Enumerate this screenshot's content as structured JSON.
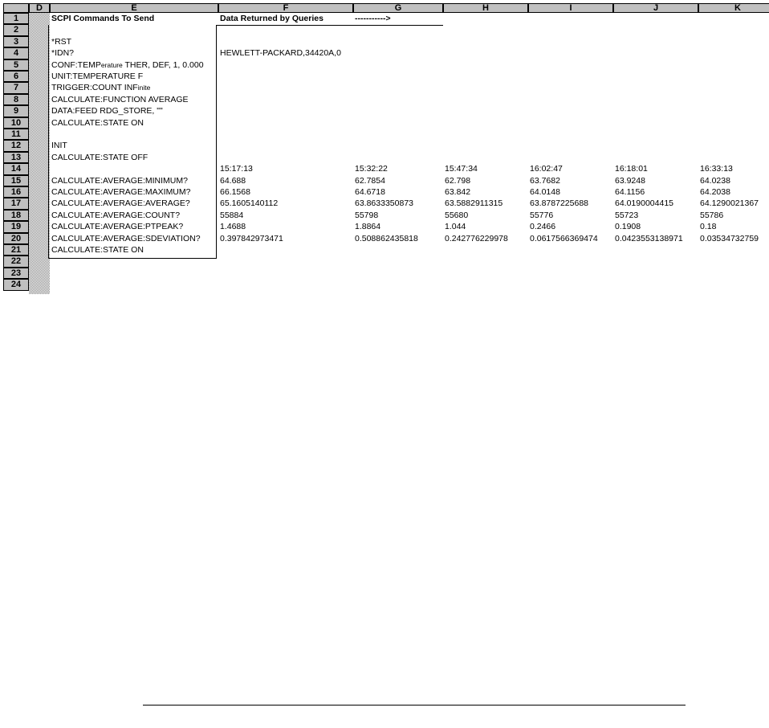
{
  "columns": [
    "D",
    "E",
    "F",
    "G",
    "H",
    "I",
    "J",
    "K"
  ],
  "rows": [
    "1",
    "2",
    "3",
    "4",
    "5",
    "6",
    "7",
    "8",
    "9",
    "10",
    "11",
    "12",
    "13",
    "14",
    "15",
    "16",
    "17",
    "18",
    "19",
    "20",
    "21",
    "22",
    "23",
    "24"
  ],
  "header": {
    "commands_title": "SCPI Commands To Send",
    "data_title": "Data Returned by Queries",
    "arrow": "----------->"
  },
  "commands": {
    "r3": "*RST",
    "r4": "*IDN?",
    "r5_a": "CONF:TEMP",
    "r5_b": "erature",
    "r5_c": " THER, DEF, 1, 0.000",
    "r6": "UNIT:TEMPERATURE F",
    "r7_a": "TRIGGER:COUNT INF",
    "r7_b": "inite",
    "r8": "CALCULATE:FUNCTION AVERAGE",
    "r9": "DATA:FEED RDG_STORE, \"\"",
    "r10": "CALCULATE:STATE ON",
    "r12": "INIT",
    "r13": "CALCULATE:STATE OFF",
    "r15": "CALCULATE:AVERAGE:MINIMUM?",
    "r16": "CALCULATE:AVERAGE:MAXIMUM?",
    "r17": "CALCULATE:AVERAGE:AVERAGE?",
    "r18": "CALCULATE:AVERAGE:COUNT?",
    "r19": "CALCULATE:AVERAGE:PTPEAK?",
    "r20": "CALCULATE:AVERAGE:SDEVIATION?",
    "r21": "CALCULATE:STATE ON"
  },
  "idn_response": "HEWLETT-PACKARD,34420A,0",
  "data": {
    "times": [
      "15:17:13",
      "15:32:22",
      "15:47:34",
      "16:02:47",
      "16:18:01",
      "16:33:13"
    ],
    "minimum": [
      "64.688",
      "62.7854",
      "62.798",
      "63.7682",
      "63.9248",
      "64.0238"
    ],
    "maximum": [
      "66.1568",
      "64.6718",
      "63.842",
      "64.0148",
      "64.1156",
      "64.2038"
    ],
    "average": [
      "65.1605140112",
      "63.8633350873",
      "63.5882911315",
      "63.8787225688",
      "64.0190004415",
      "64.1290021367"
    ],
    "count": [
      "55884",
      "55798",
      "55680",
      "55776",
      "55723",
      "55786"
    ],
    "ptpeak": [
      "1.4688",
      "1.8864",
      "1.044",
      "0.2466",
      "0.1908",
      "0.18"
    ],
    "sdev": [
      "0.397842973471",
      "0.508862435818",
      "0.242776229978",
      "0.0617566369474",
      "0.0423553138971",
      "0.03534732759"
    ]
  }
}
